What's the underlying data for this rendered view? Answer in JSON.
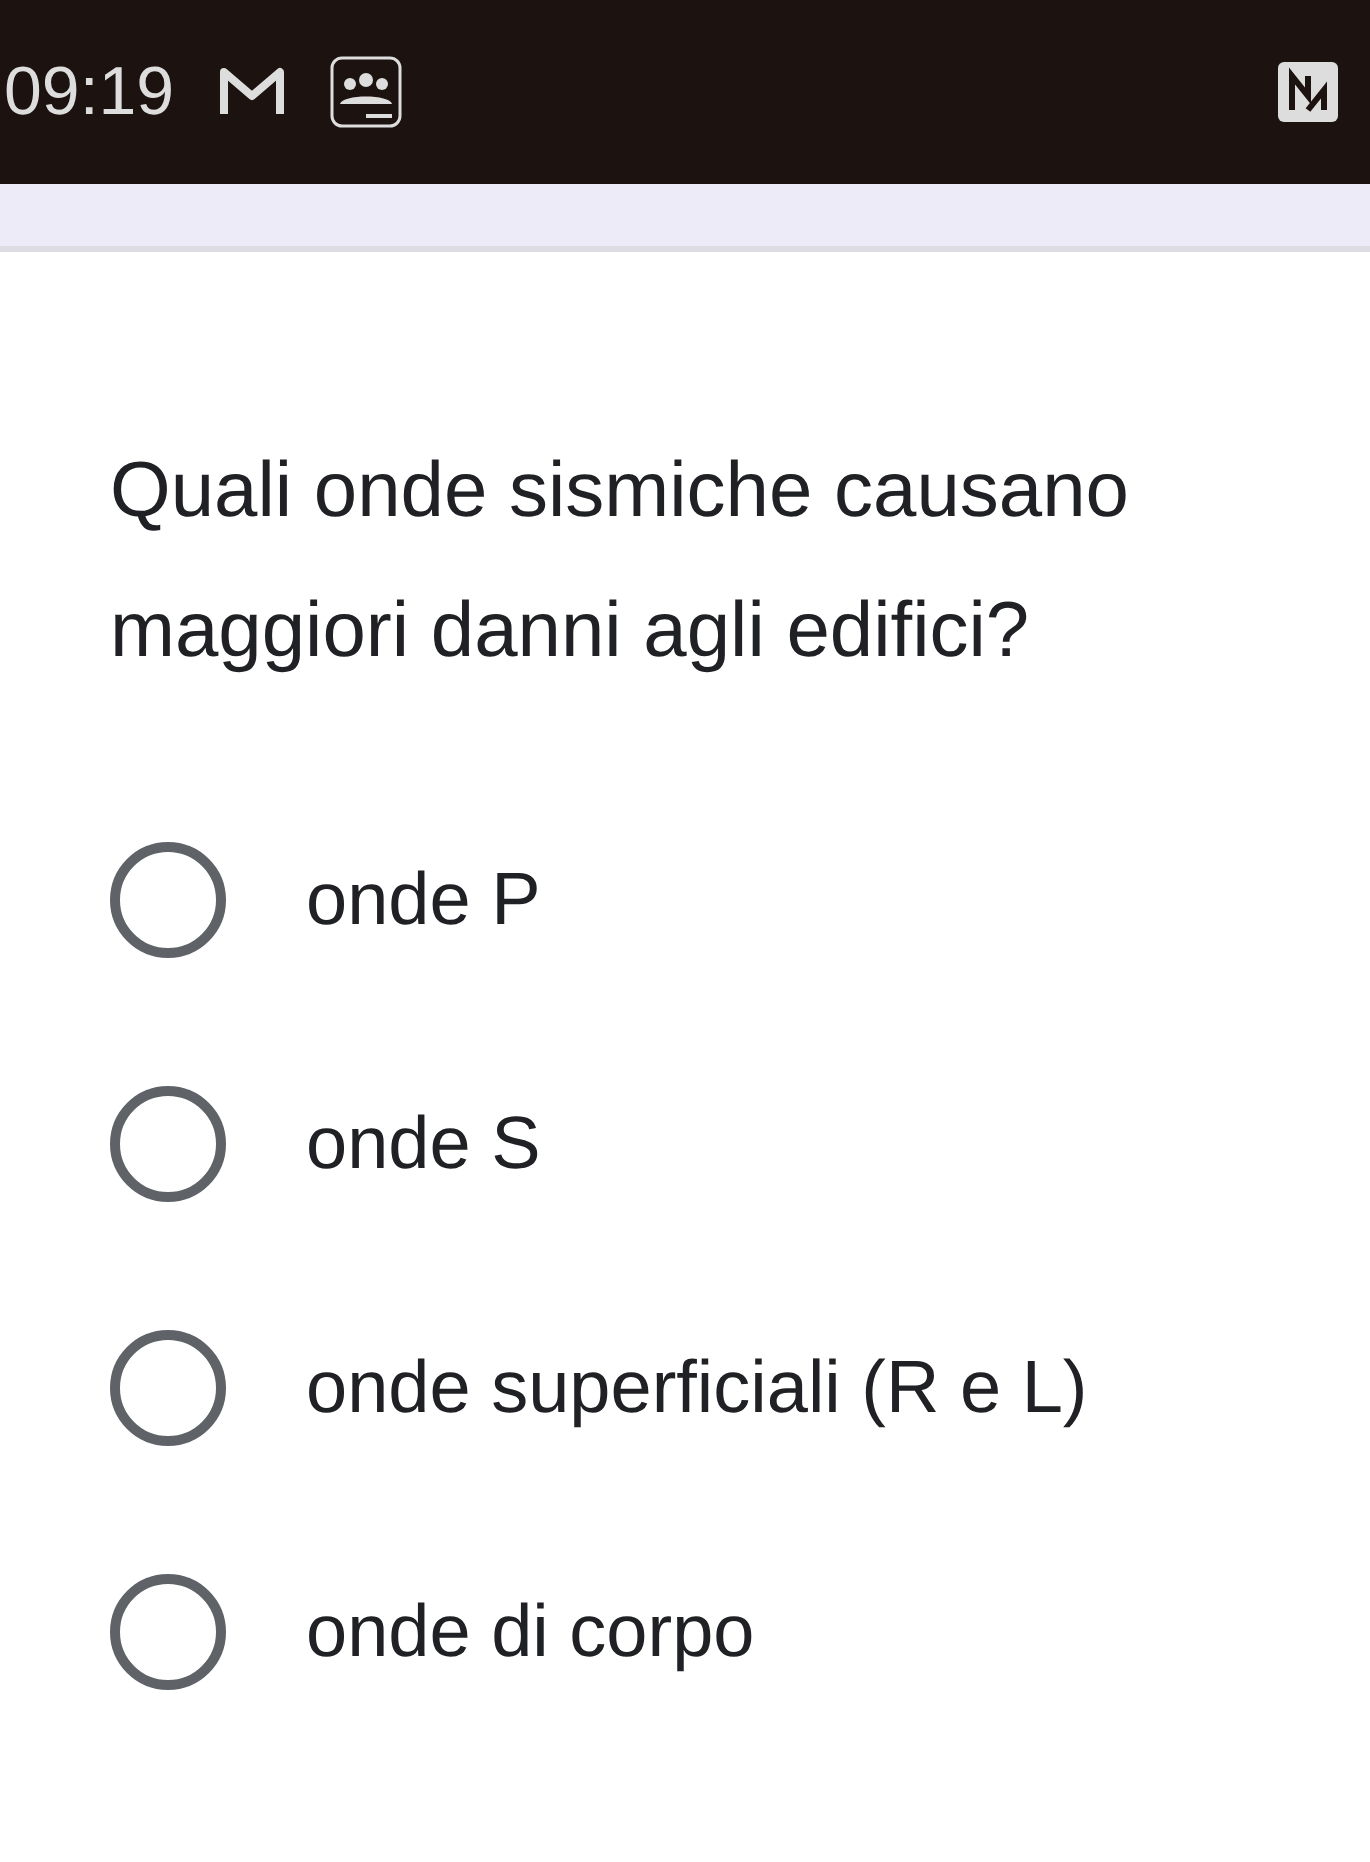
{
  "status_bar": {
    "time": "09:19"
  },
  "question": "Quali onde sismiche causano maggiori danni agli edifici?",
  "options": [
    {
      "label": "onde P",
      "selected": false
    },
    {
      "label": "onde S",
      "selected": false
    },
    {
      "label": "onde superficiali (R e L)",
      "selected": false
    },
    {
      "label": "onde di corpo",
      "selected": false
    }
  ]
}
